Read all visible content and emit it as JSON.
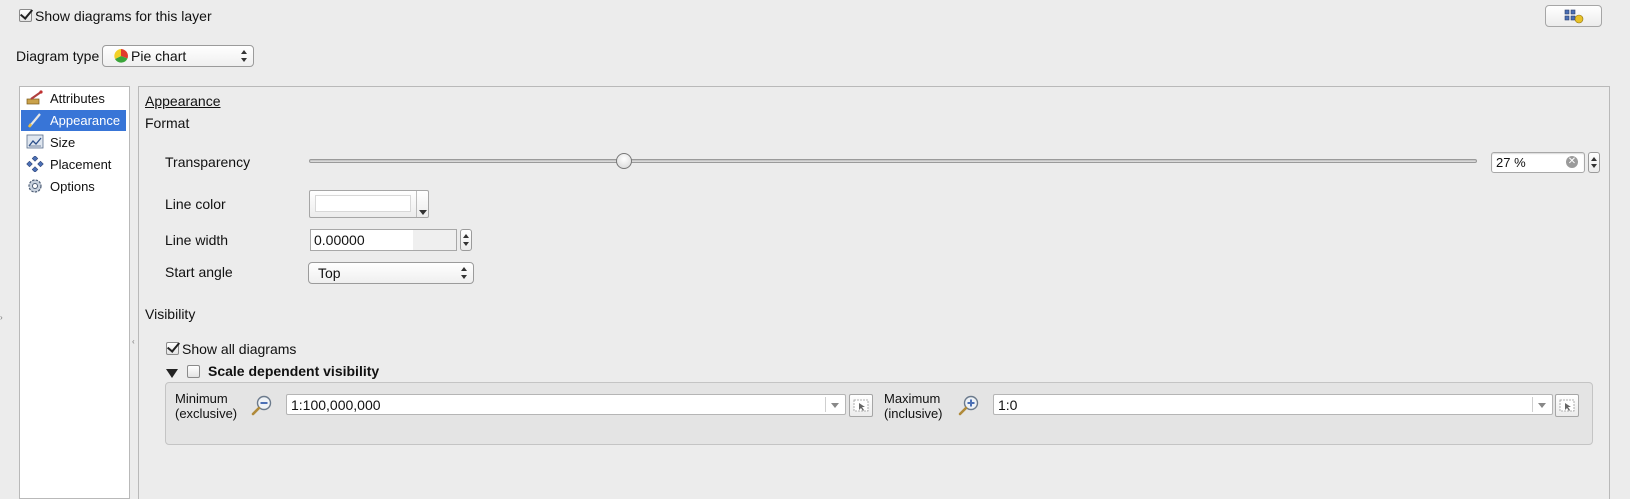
{
  "show_diagrams": {
    "label": "Show diagrams for this layer",
    "checked": true
  },
  "top_right_button": {
    "icon": "diagram-settings-icon"
  },
  "diagram_type": {
    "label": "Diagram type",
    "value": "Pie chart",
    "icon": "pie-chart-icon"
  },
  "sidebar": {
    "items": [
      {
        "label": "Attributes",
        "icon": "attributes-icon",
        "selected": false
      },
      {
        "label": "Appearance",
        "icon": "appearance-icon",
        "selected": true
      },
      {
        "label": "Size",
        "icon": "size-icon",
        "selected": false
      },
      {
        "label": "Placement",
        "icon": "placement-icon",
        "selected": false
      },
      {
        "label": "Options",
        "icon": "options-icon",
        "selected": false
      }
    ]
  },
  "panel": {
    "title": "Appearance",
    "format_heading": "Format",
    "transparency": {
      "label": "Transparency",
      "value": "27 %",
      "fraction": 0.27
    },
    "line_color": {
      "label": "Line color",
      "color": "#ffffff"
    },
    "line_width": {
      "label": "Line width",
      "value": "0.00000"
    },
    "start_angle": {
      "label": "Start angle",
      "value": "Top"
    },
    "visibility_heading": "Visibility",
    "show_all": {
      "label": "Show all diagrams",
      "checked": true
    },
    "scale_dep": {
      "label": "Scale dependent visibility",
      "checked": false,
      "expanded": true
    },
    "minimum": {
      "label_line1": "Minimum",
      "label_line2": "(exclusive)",
      "value": "1:100,000,000"
    },
    "maximum": {
      "label_line1": "Maximum",
      "label_line2": "(inclusive)",
      "value": "1:0"
    }
  },
  "colors": {
    "selection": "#3875d7",
    "background": "#ececec"
  }
}
